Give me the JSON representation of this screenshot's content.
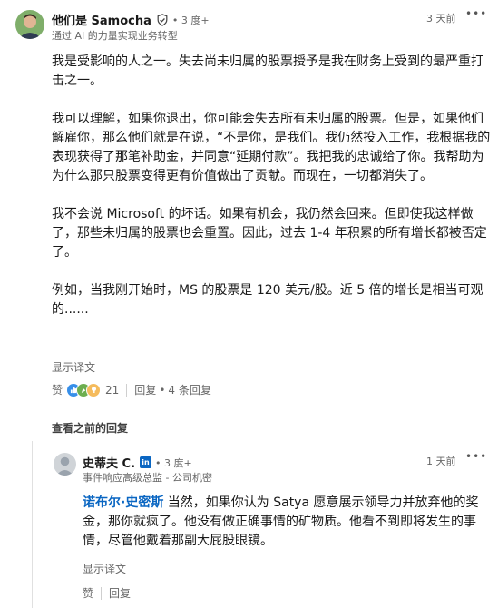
{
  "main_comment": {
    "author_name": "他们是 Samocha",
    "degree": "• 3 度+",
    "headline": "通过 AI 的力量实现业务转型",
    "timestamp": "3 天前",
    "more": "•••",
    "paragraphs": [
      "我是受影响的人之一。失去尚未归属的股票授予是我在财务上受到的最严重打击之一。",
      "我可以理解，如果你退出，你可能会失去所有未归属的股票。但是，如果他们解雇你，那么他们就是在说，“不是你，是我们。我仍然投入工作，我根据我的表现获得了那笔补助金，并同意“延期付款”。我把我的忠诚给了你。我帮助为为什么那只股票变得更有价值做出了贡献。而现在，一切都消失了。",
      "我不会说 Microsoft 的坏话。如果有机会，我仍然会回来。但即使我这样做了，那些未归属的股票也会重置。因此，过去 1-4 年积累的所有增长都被否定了。",
      "例如，当我刚开始时，MS 的股票是 120 美元/股。近 5 倍的增长是相当可观的......"
    ],
    "show_translation": "显示译文",
    "like_label": "赞",
    "reaction_count": "21",
    "reply_label": "回复",
    "replies_count": "4 条回复"
  },
  "view_previous_replies": "查看之前的回复",
  "reply_comment": {
    "author_name": "史蒂夫 C.",
    "in_badge": "in",
    "degree": "• 3 度+",
    "headline": "事件响应高级总监 - 公司机密",
    "timestamp": "1 天前",
    "more": "•••",
    "mention": "诺布尔·史密斯",
    "text": " 当然，如果你认为 Satya 愿意展示领导力并放弃他的奖金，那你就疯了。他没有做正确事情的矿物质。他看不到即将发生的事情，尽管他戴着那副大屁股眼镜。",
    "show_translation": "显示译文",
    "like_label": "赞",
    "reply_label": "回复"
  },
  "colors": {
    "link_blue": "#0a66c2",
    "text": "#191919",
    "muted": "#666666"
  }
}
